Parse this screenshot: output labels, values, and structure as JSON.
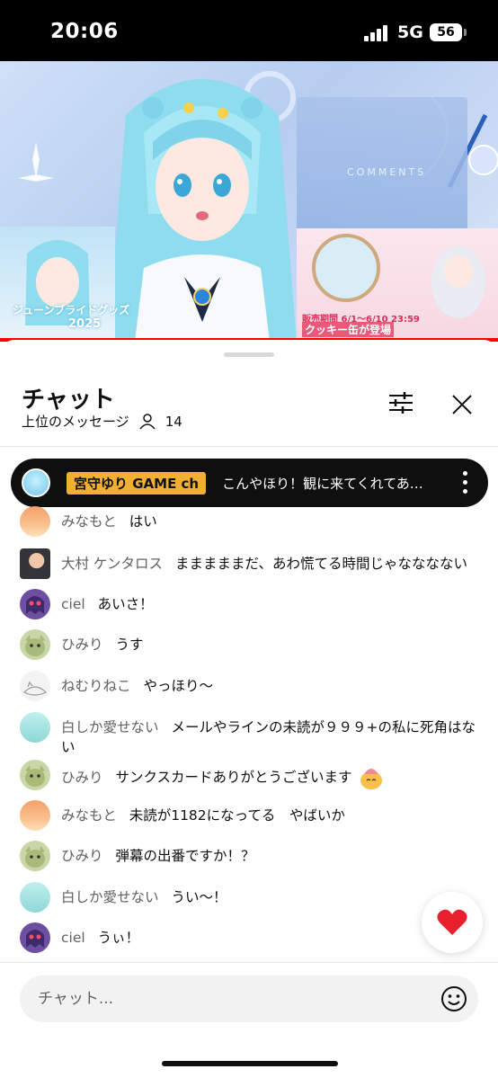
{
  "status_bar": {
    "time": "20:06",
    "network": "5G",
    "battery": "56"
  },
  "video": {
    "panel_title": "COMMENTS",
    "left_thumb_title": "ジューンブライドグッズ",
    "left_thumb_year": "2025",
    "right_thumb_line1": "販売期間 6/1〜6/10 23:59",
    "right_thumb_line2": "クッキー缶が登場"
  },
  "chat": {
    "title": "チャット",
    "subtitle": "上位のメッセージ",
    "viewer_count": "14",
    "pinned": {
      "author": "宮守ゆり GAME ch",
      "text": "こんやほり！観に来てくれてあ…"
    },
    "messages": [
      {
        "author": "みなもと",
        "text": "はい",
        "avatar": "orange"
      },
      {
        "author": "大村 ケンタロス",
        "text": "まままままだ、あわ慌てる時間じゃなななない",
        "avatar": "photo"
      },
      {
        "author": "ciel",
        "text": "あいさ！",
        "avatar": "ghost"
      },
      {
        "author": "ひみり",
        "text": "うす",
        "avatar": "green"
      },
      {
        "author": "ねむりねこ",
        "text": "やっほり〜",
        "avatar": "sketch"
      },
      {
        "author": "白しか愛せない",
        "text": "メールやラインの未読が９９９+の私に死角はない",
        "avatar": "teal"
      },
      {
        "author": "ひみり",
        "text": "サンクスカードありがとうございます",
        "avatar": "green"
      },
      {
        "author": "みなもと",
        "text": "未読が1182になってる　やばいか",
        "avatar": "orange"
      },
      {
        "author": "ひみり",
        "text": "弾幕の出番ですか！？",
        "avatar": "green"
      },
      {
        "author": "白しか愛せない",
        "text": "うい〜！",
        "avatar": "teal"
      },
      {
        "author": "ciel",
        "text": "うぃ！",
        "avatar": "ghost"
      }
    ],
    "input_placeholder": "チャット..."
  },
  "icons": {
    "filter": "sliders-icon",
    "close": "close-icon",
    "more": "vertical-dots-icon",
    "heart": "heart-icon",
    "emoji": "smiley-icon",
    "viewers": "person-icon"
  },
  "colors": {
    "accent_red": "#ff0000",
    "badge_gold": "#f2b033",
    "text_secondary": "#606060"
  }
}
